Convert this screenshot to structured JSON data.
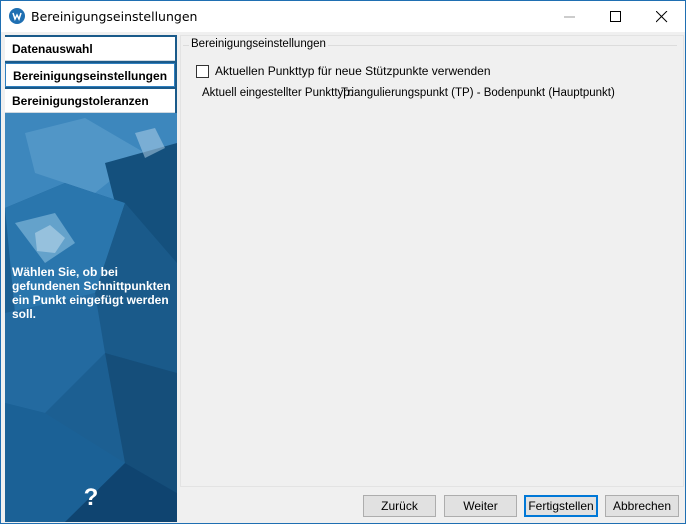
{
  "window": {
    "title": "Bereinigungseinstellungen"
  },
  "sidebar": {
    "items": [
      {
        "label": "Datenauswahl"
      },
      {
        "label": "Bereinigungseinstellungen"
      },
      {
        "label": "Bereinigungstoleranzen"
      }
    ],
    "description": "Wählen Sie, ob bei gefundenen Schnittpunkten ein Punkt eingefügt werden soll.",
    "help_glyph": "?"
  },
  "settings": {
    "group_title": "Bereinigungseinstellungen",
    "checkbox_label": "Aktuellen Punkttyp für neue Stützpunkte verwenden",
    "checkbox_checked": false,
    "current_label": "Aktuell eingestellter Punkttyp:",
    "current_value": "Triangulierungspunkt (TP) - Bodenpunkt (Hauptpunkt)"
  },
  "buttons": {
    "back": "Zurück",
    "next": "Weiter",
    "finish": "Fertigstellen",
    "cancel": "Abbrechen"
  },
  "colors": {
    "accent": "#0078d7",
    "sidebar_bg": "#1a5a8a"
  }
}
